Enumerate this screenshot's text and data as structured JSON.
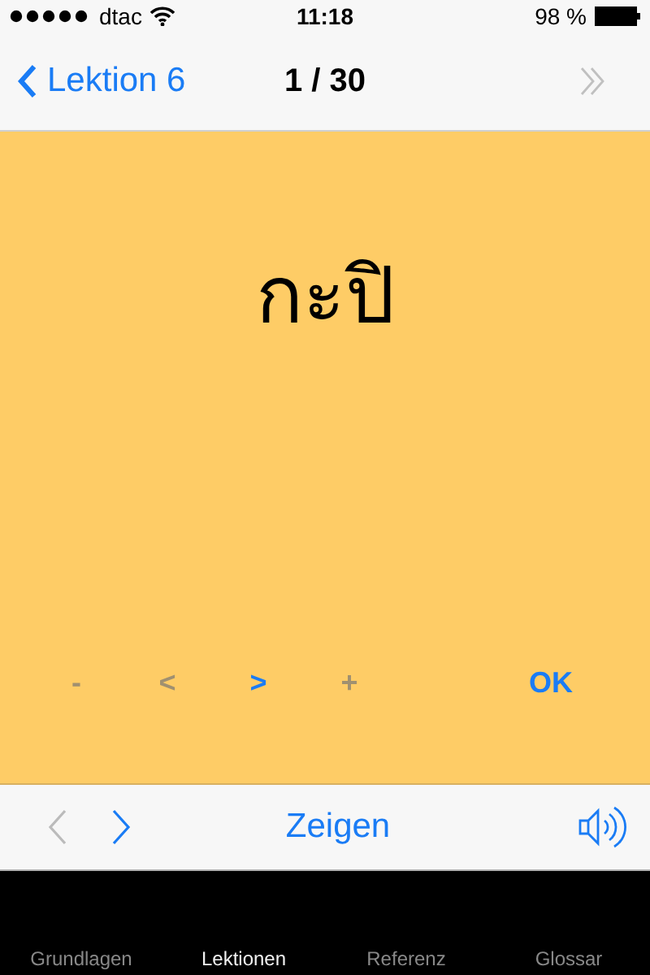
{
  "status_bar": {
    "carrier": "dtac",
    "time": "11:18",
    "battery": "98 %"
  },
  "nav": {
    "back_label": "Lektion 6",
    "title": "1 / 30",
    "skip_disabled": true
  },
  "card": {
    "word": "กะปิ",
    "controls": [
      {
        "label": "-",
        "disabled": true
      },
      {
        "label": "<",
        "disabled": true
      },
      {
        "label": ">",
        "disabled": false
      },
      {
        "label": "+",
        "disabled": true
      },
      {
        "label": "OK",
        "disabled": false
      }
    ]
  },
  "toolbar": {
    "prev_disabled": true,
    "next_disabled": false,
    "action": "Zeigen"
  },
  "tabs": [
    {
      "label": "Grundlagen",
      "selected": false
    },
    {
      "label": "Lektionen",
      "selected": true
    },
    {
      "label": "Referenz",
      "selected": false
    },
    {
      "label": "Glossar",
      "selected": false
    }
  ]
}
